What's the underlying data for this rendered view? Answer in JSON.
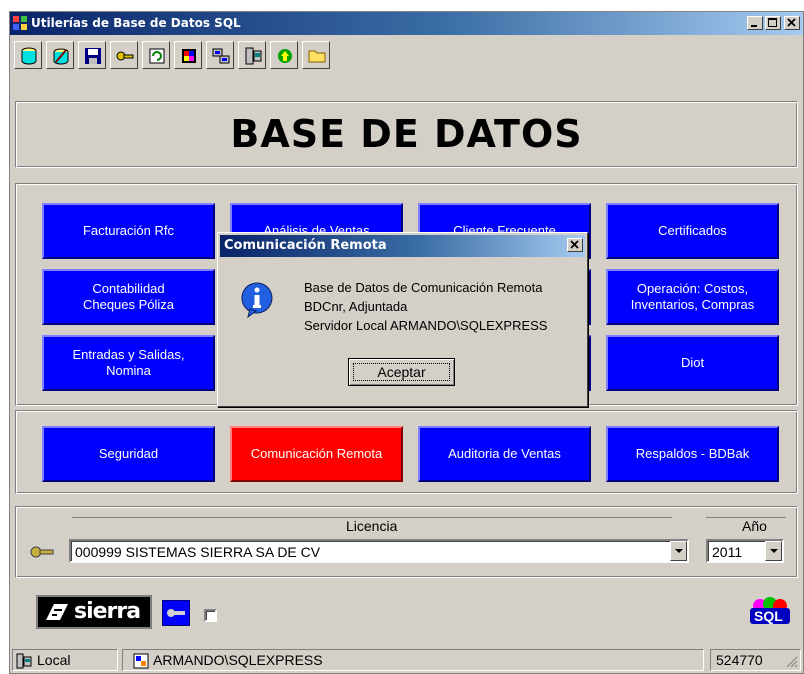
{
  "window": {
    "title": "Utilerías de Base de Datos SQL"
  },
  "toolbar": {
    "icons": [
      "open-database-icon",
      "edit-icon",
      "save-icon",
      "key-icon",
      "refresh-icon",
      "palette-icon",
      "network-icon",
      "server-icon",
      "recycle-icon",
      "folder-icon"
    ]
  },
  "banner": {
    "title": "BASE DE DATOS"
  },
  "modules": [
    {
      "label": "Facturación Rfc"
    },
    {
      "label": "Análisis de Ventas"
    },
    {
      "label": "Cliente Frecuente"
    },
    {
      "label": "Certificados"
    },
    {
      "label": "Contabilidad\nCheques Póliza"
    },
    {
      "label": ""
    },
    {
      "label": ""
    },
    {
      "label": "Operación:  Costos,\nInventarios,  Compras"
    },
    {
      "label": "Entradas y Salidas,\nNomina"
    },
    {
      "label": ""
    },
    {
      "label": ""
    },
    {
      "label": "Diot"
    }
  ],
  "actions": [
    {
      "label": "Seguridad"
    },
    {
      "label": "Comunicación Remota",
      "color": "#ff0000"
    },
    {
      "label": "Auditoria de Ventas"
    },
    {
      "label": "Respaldos - BDBak"
    }
  ],
  "licencia": {
    "label": "Licencia",
    "value": "000999  SISTEMAS SIERRA SA DE CV"
  },
  "anio": {
    "label": "Año",
    "value": "2011"
  },
  "footer": {
    "logo_text": "sierra",
    "sql_logo": "SQL"
  },
  "statusbar": {
    "location": "Local",
    "server": "ARMANDO\\SQLEXPRESS",
    "code": "524770"
  },
  "dialog": {
    "title": "Comunicación Remota",
    "lines": [
      "Base de Datos de Comunicación Remota",
      "BDCnr, Adjuntada",
      "Servidor Local ARMANDO\\SQLEXPRESS"
    ],
    "ok_label": "Aceptar",
    "icon": "info-icon"
  },
  "colors": {
    "module_button": "#0000ff",
    "active_button": "#ff0000",
    "titlebar": "#0a246a"
  }
}
